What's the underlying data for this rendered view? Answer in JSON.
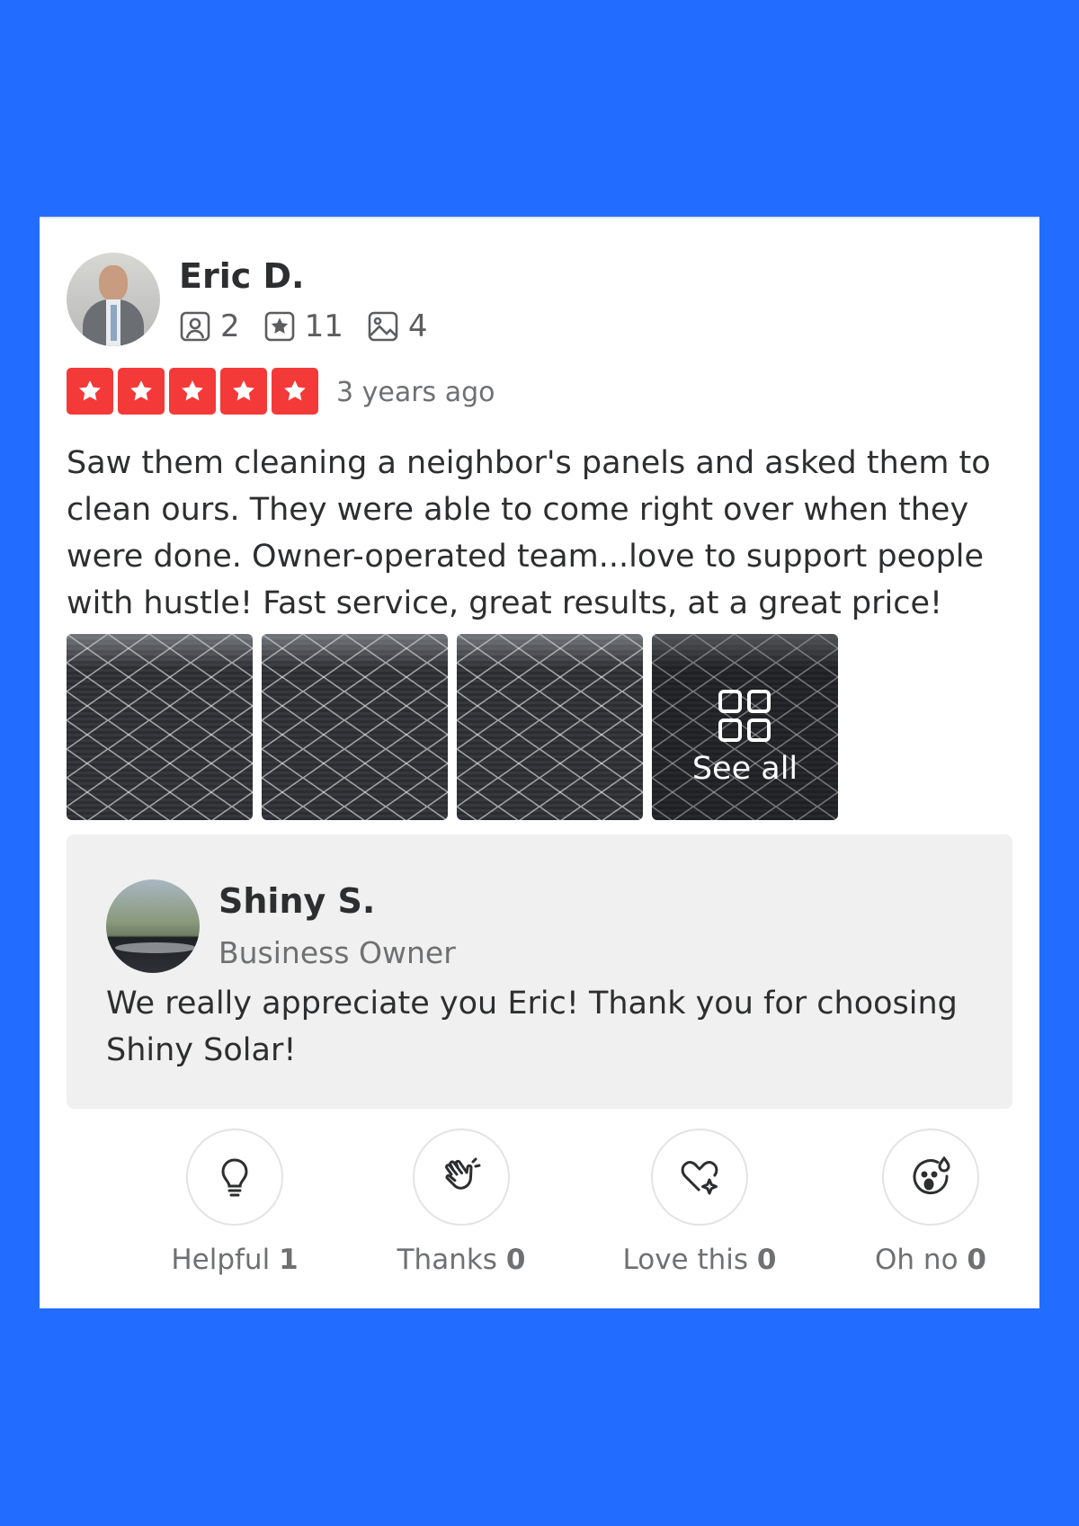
{
  "review": {
    "reviewer_name": "Eric D.",
    "stats": {
      "friends": "2",
      "reviews": "11",
      "photos": "4"
    },
    "rating": 5,
    "date": "3 years ago",
    "text": "Saw them cleaning a neighbor's panels and asked them to clean ours. They were able to come right over when they were done. Owner-operated team...love to support people with hustle! Fast service, great results, at a great price!",
    "see_all_label": "See all"
  },
  "owner_reply": {
    "name": "Shiny S.",
    "role": "Business Owner",
    "text": "We really appreciate you Eric! Thank you for choosing Shiny Solar!"
  },
  "reactions": [
    {
      "label": "Helpful",
      "count": "1",
      "icon": "lightbulb-icon"
    },
    {
      "label": "Thanks",
      "count": "0",
      "icon": "clapping-hands-icon"
    },
    {
      "label": "Love this",
      "count": "0",
      "icon": "heart-sparkle-icon"
    },
    {
      "label": "Oh no",
      "count": "0",
      "icon": "shocked-face-icon"
    }
  ],
  "colors": {
    "background": "#226DFF",
    "star_red": "#F43939",
    "reply_bg": "#F0F0F0"
  }
}
